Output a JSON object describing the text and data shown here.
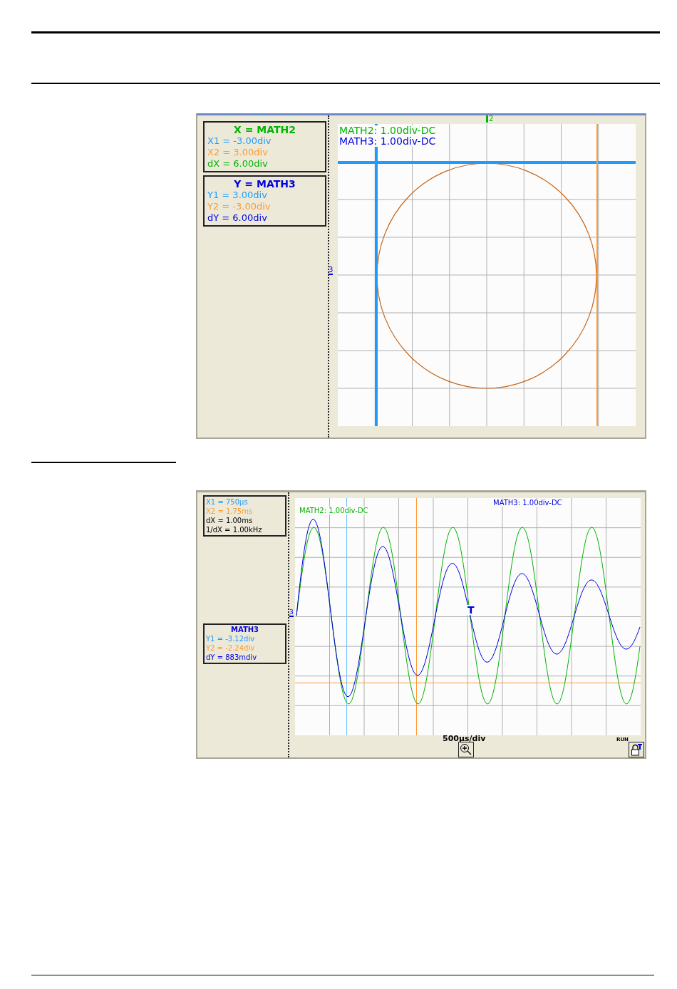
{
  "xy_view": {
    "readouts": [
      {
        "title": {
          "text": "X = MATH2",
          "color": "#00b400"
        },
        "lines": [
          {
            "text": "X1 = -3.00div",
            "color": "#1e9bff"
          },
          {
            "text": "X2 = 3.00div",
            "color": "#ff9933"
          },
          {
            "text": "dX = 6.00div",
            "color": "#00b400"
          }
        ]
      },
      {
        "title": {
          "text": "Y = MATH3",
          "color": "#0000e0"
        },
        "lines": [
          {
            "text": "Y1 = 3.00div",
            "color": "#1e9bff"
          },
          {
            "text": "Y2 = -3.00div",
            "color": "#ff9933"
          },
          {
            "text": "dY = 6.00div",
            "color": "#0000e0"
          }
        ]
      }
    ],
    "traces": [
      {
        "label": "MATH2: 1.00div-DC",
        "color": "#00b400"
      },
      {
        "label": "MATH3: 1.00div-DC",
        "color": "#0000e0"
      }
    ],
    "x_marker": "2",
    "y_marker": "3"
  },
  "time_view": {
    "readouts": [
      {
        "lines": [
          {
            "text": "X1 = 750µs",
            "color": "#1e9bff"
          },
          {
            "text": "X2 = 1.75ms",
            "color": "#ff9933"
          },
          {
            "text": "dX = 1.00ms",
            "color": "#000000"
          },
          {
            "text": "1/dX = 1.00kHz",
            "color": "#000000"
          }
        ]
      },
      {
        "title": {
          "text": "MATH3",
          "color": "#0000e0"
        },
        "lines": [
          {
            "text": "Y1 = -3.12div",
            "color": "#1e9bff"
          },
          {
            "text": "Y2 = -2.24div",
            "color": "#ff9933"
          },
          {
            "text": "dY = 883mdiv",
            "color": "#0000e0"
          }
        ]
      }
    ],
    "traces": [
      {
        "label": "MATH2: 1.00div-DC",
        "color": "#00b400"
      },
      {
        "label": "MATH3: 1.00div-DC",
        "color": "#0000e0"
      }
    ],
    "level_marker": "3",
    "trigger_marker": "T",
    "timebase": "500µs/div",
    "status": "RUN"
  }
}
